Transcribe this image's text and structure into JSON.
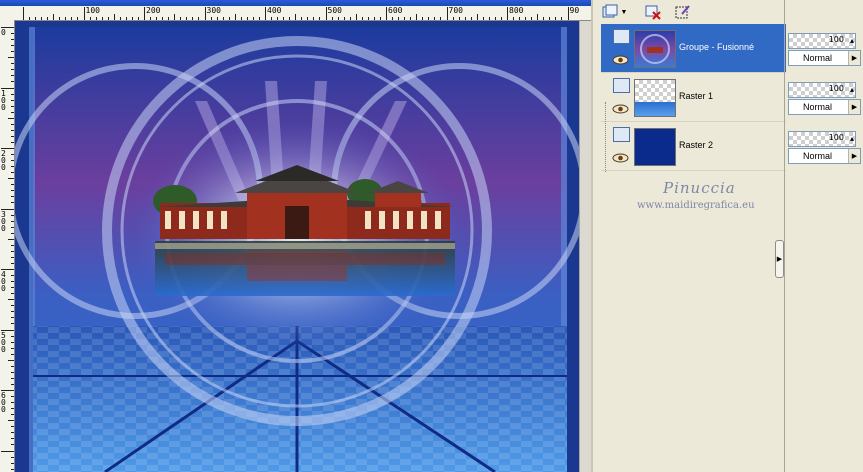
{
  "canvas": {
    "ruler_h_labels": [
      "100",
      "200",
      "300",
      "400",
      "500",
      "600",
      "700",
      "800",
      "90"
    ],
    "ruler_v_labels": [
      "0",
      "100",
      "200",
      "300",
      "400",
      "500",
      "600"
    ],
    "image_description_icon": "temple-photo"
  },
  "toolbar": {
    "new_layer_icon": "new-layer-icon",
    "delete_layer_icon": "delete-layer-icon",
    "edit_selection_icon": "edit-selection-icon"
  },
  "layers": [
    {
      "name": "Groupe - Fusionné",
      "selected": true,
      "opacity": "100",
      "blend": "Normal"
    },
    {
      "name": "Raster 1",
      "selected": false,
      "opacity": "100",
      "blend": "Normal"
    },
    {
      "name": "Raster 2",
      "selected": false,
      "opacity": "100",
      "blend": "Normal"
    }
  ],
  "watermark": {
    "title": "Pinuccia",
    "url": "www.maidiregrafica.eu"
  },
  "colors": {
    "selection": "#316ac5",
    "raster2_fill": "#0a2a8c",
    "palette_bg": "#ece9d8"
  }
}
